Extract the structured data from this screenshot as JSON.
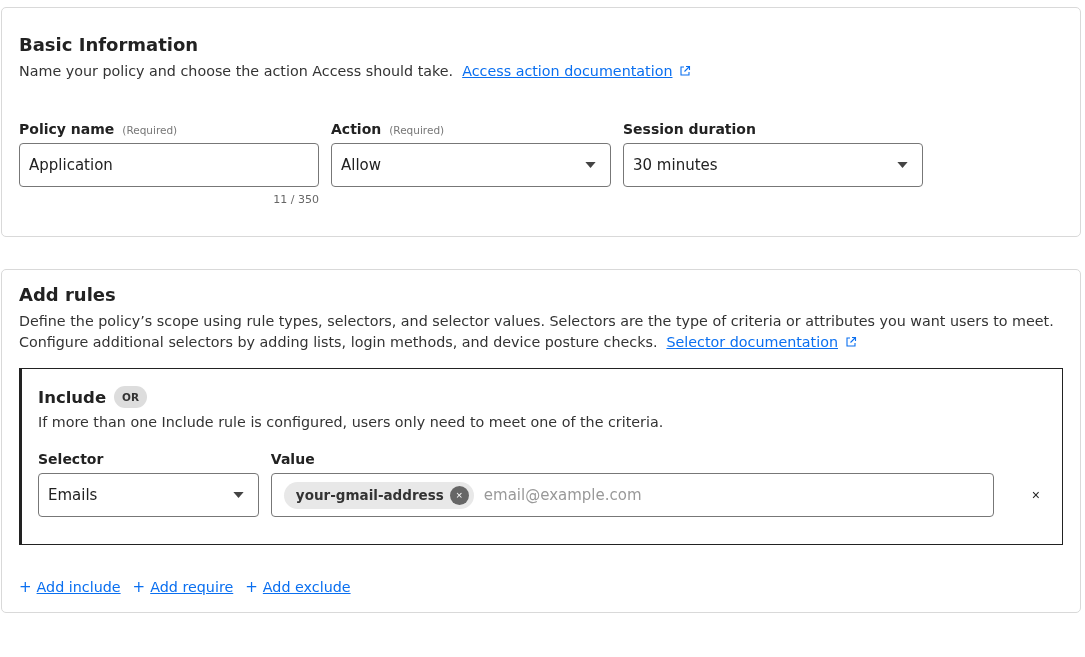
{
  "basic_information": {
    "title": "Basic Information",
    "description": "Name your policy and choose the action Access should take.",
    "doc_link": "Access action documentation",
    "fields": [
      {
        "kind": "text",
        "label": "Policy name",
        "hint": "(Required)",
        "value": "Application",
        "counter": "11 / 350"
      },
      {
        "kind": "select",
        "label": "Action",
        "hint": "(Required)",
        "value": "Allow"
      },
      {
        "kind": "select",
        "label": "Session duration",
        "value": "30 minutes"
      }
    ]
  },
  "add_rules": {
    "title": "Add rules",
    "description_lines": [
      "Define the policy’s scope using rule types, selectors, and selector values. Selectors are the type of criteria or attributes you want users to meet.",
      "Configure additional selectors by adding lists, login methods, and device posture checks."
    ],
    "doc_link": "Selector documentation",
    "include": {
      "title": "Include",
      "badge": "OR",
      "description": "If more than one Include rule is configured, users only need to meet one of the criteria.",
      "selector": {
        "label": "Selector",
        "value": "Emails"
      },
      "value": {
        "label": "Value",
        "chips": [
          {
            "text": "your-gmail-address",
            "remove": "×"
          }
        ],
        "placeholder": "email@example.com"
      },
      "remove": "×"
    },
    "actions": [
      {
        "prefix": "+",
        "label": "Add include"
      },
      {
        "prefix": "+",
        "label": "Add require"
      },
      {
        "prefix": "+",
        "label": "Add exclude"
      }
    ]
  }
}
